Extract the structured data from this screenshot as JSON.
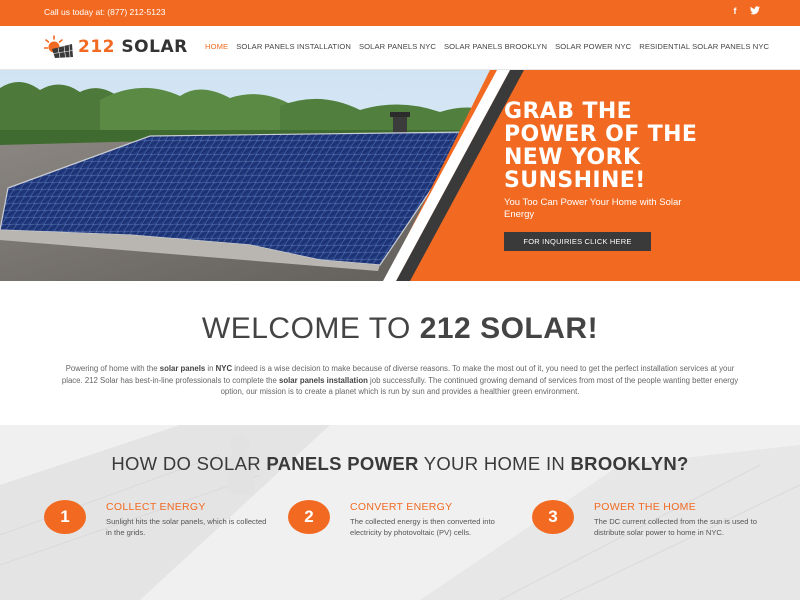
{
  "topbar": {
    "phone": "Call us today at: (877) 212-5123",
    "social": [
      {
        "icon": "facebook-icon",
        "glyph": "f"
      },
      {
        "icon": "twitter-icon",
        "glyph": "t"
      }
    ]
  },
  "header": {
    "logo_number": "212",
    "logo_word": "SOLAR",
    "nav": [
      {
        "label": "HOME",
        "active": true
      },
      {
        "label": "SOLAR PANELS INSTALLATION",
        "active": false
      },
      {
        "label": "SOLAR PANELS NYC",
        "active": false
      },
      {
        "label": "SOLAR PANELS BROOKLYN",
        "active": false
      },
      {
        "label": "SOLAR POWER NYC",
        "active": false
      },
      {
        "label": "RESIDENTIAL SOLAR PANELS NYC",
        "active": false
      }
    ]
  },
  "hero": {
    "headline_lines": [
      "GRAB THE",
      "POWER OF THE",
      "NEW YORK",
      "SUNSHINE!"
    ],
    "subtitle": "You Too Can Power Your Home with Solar Energy",
    "button": "FOR INQUIRIES CLICK HERE"
  },
  "welcome": {
    "title_prefix": "WELCOME TO ",
    "title_bold": "212 SOLAR!",
    "text_1": "Powering of home with the ",
    "text_bold_1": "solar panels",
    "text_2": " in ",
    "text_bold_2": "NYC",
    "text_3": " indeed is a wise decision to make because of diverse reasons. To make the most out of it, you need to get the perfect installation services at your place. 212 Solar has best-in-line professionals to complete the ",
    "text_bold_3": "solar panels installation",
    "text_4": " job successfully. The continued growing demand of services from most of the people wanting better energy option, our mission is to create a planet which is run by sun and provides a healthier green environment."
  },
  "how": {
    "title_1": "HOW DO SOLAR ",
    "title_bold_1": "PANELS POWER",
    "title_2": " YOUR HOME IN ",
    "title_bold_2": "BROOKLYN?",
    "steps": [
      {
        "number": "1",
        "title": "COLLECT ENERGY",
        "text": "Sunlight hits the solar panels, which is collected in the grids."
      },
      {
        "number": "2",
        "title": "CONVERT ENERGY",
        "text": "The collected energy is then converted into electricity by photovoltaic (PV) cells."
      },
      {
        "number": "3",
        "title": "POWER THE HOME",
        "text": "The DC current collected from the sun is used to distribute solar power to home in NYC."
      }
    ]
  },
  "colors": {
    "accent": "#f26a21",
    "dark_button": "#3a3a3a"
  }
}
